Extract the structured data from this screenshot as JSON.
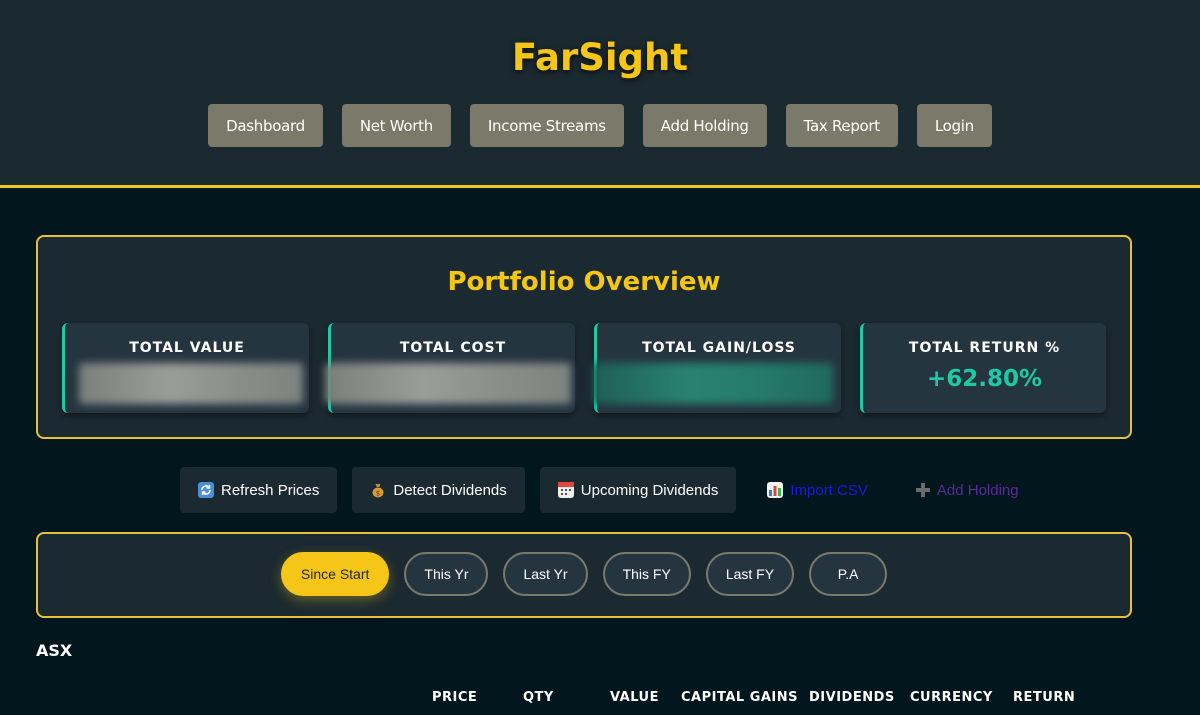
{
  "app": {
    "title": "FarSight"
  },
  "nav": [
    "Dashboard",
    "Net Worth",
    "Income Streams",
    "Add Holding",
    "Tax Report",
    "Login"
  ],
  "overview": {
    "title": "Portfolio Overview",
    "stats": [
      {
        "label": "TOTAL VALUE",
        "value": ""
      },
      {
        "label": "TOTAL COST",
        "value": ""
      },
      {
        "label": "TOTAL GAIN/LOSS",
        "value": ""
      },
      {
        "label": "TOTAL RETURN %",
        "value": "+62.80%"
      }
    ]
  },
  "actions": {
    "refresh": "Refresh Prices",
    "detect": "Detect Dividends",
    "upcoming": "Upcoming Dividends",
    "import": "Import CSV",
    "add": "Add Holding"
  },
  "periods": [
    "Since Start",
    "This Yr",
    "Last Yr",
    "This FY",
    "Last FY",
    "P.A"
  ],
  "active_period": "Since Start",
  "section": "ASX",
  "table_headers": [
    "PRICE",
    "QTY",
    "VALUE",
    "CAPITAL GAINS",
    "DIVIDENDS",
    "CURRENCY",
    "RETURN"
  ],
  "colors": {
    "accent": "#f5c518",
    "positive": "#1fc9a5",
    "nav_button": "#7b7a6a"
  },
  "icons": {
    "refresh": "refresh-icon",
    "detect": "money-bag-icon",
    "upcoming": "calendar-icon",
    "import": "bar-chart-icon",
    "add": "plus-icon"
  }
}
